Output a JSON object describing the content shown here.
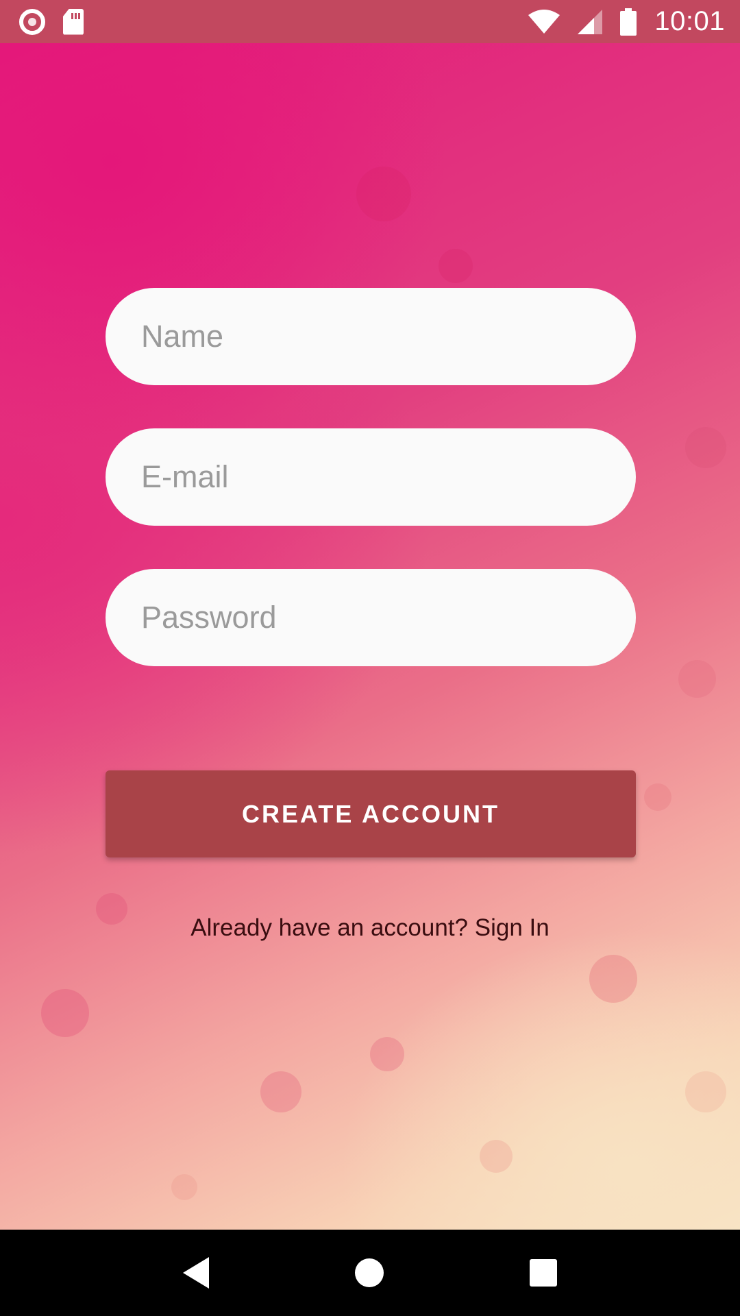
{
  "status_bar": {
    "time": "10:01",
    "icons": [
      "screen-record-icon",
      "sd-card-icon",
      "wifi-icon",
      "cell-signal-icon",
      "battery-icon"
    ]
  },
  "form": {
    "name_placeholder": "Name",
    "email_placeholder": "E-mail",
    "password_placeholder": "Password",
    "create_account_label": "CREATE ACCOUNT",
    "sign_in_text": "Already have an account? Sign In"
  },
  "nav_bar": {
    "icons": [
      "back-icon",
      "home-icon",
      "recents-icon"
    ]
  },
  "colors": {
    "status_bar": "#c2485f",
    "button": "#a94348",
    "background_top": "#e3197a",
    "background_bottom": "#f9e6c7",
    "link_text": "#3a0d10"
  }
}
